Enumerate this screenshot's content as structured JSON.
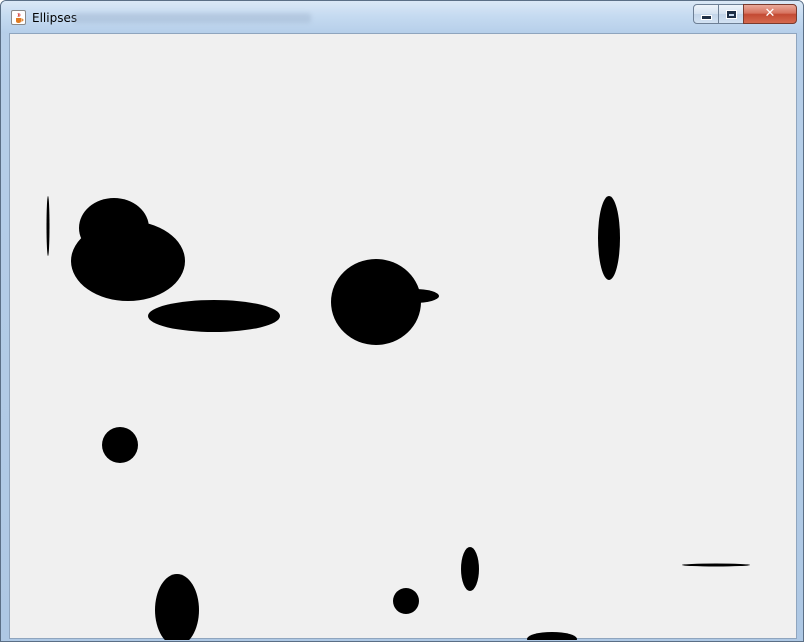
{
  "window": {
    "title": "Ellipses",
    "canvas_color": "#f0f0f0",
    "fill_color": "#000000"
  },
  "title_bar": {
    "icon": "java-cup-icon",
    "controls": [
      {
        "name": "minimize",
        "icon": "minimize-icon"
      },
      {
        "name": "maximize",
        "icon": "maximize-icon"
      },
      {
        "name": "close",
        "icon": "close-icon"
      }
    ]
  },
  "ellipses_count": 17
}
